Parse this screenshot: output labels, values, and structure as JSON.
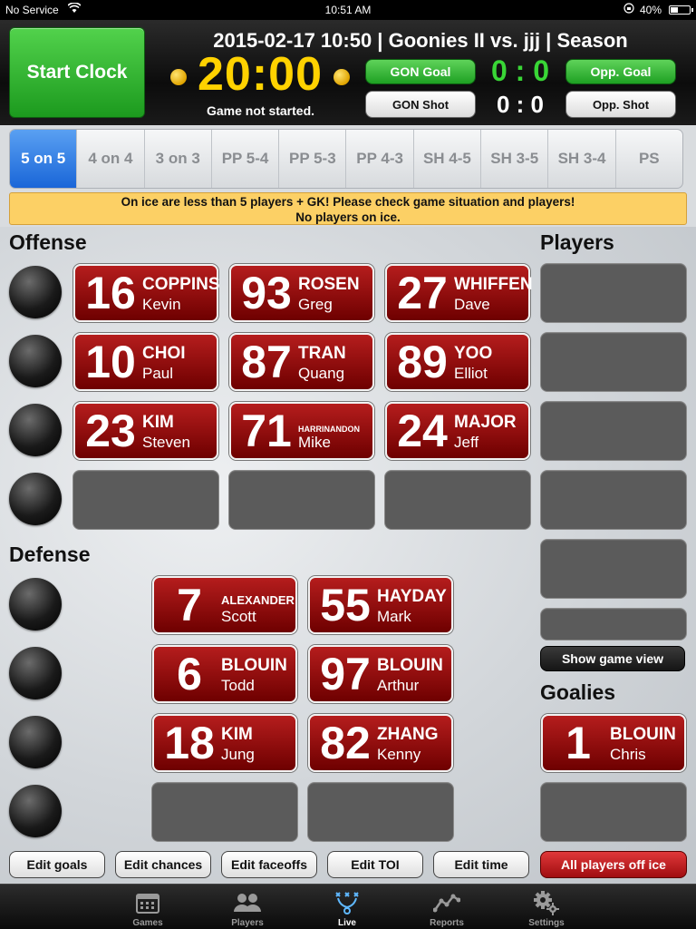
{
  "status_bar": {
    "carrier": "No Service",
    "time": "10:51 AM",
    "battery": "40%",
    "battery_level": 0.4
  },
  "header": {
    "start_clock": "Start Clock",
    "title": "2015-02-17 10:50 | Goonies II vs. jjj | Season",
    "clock_min": "20",
    "clock_sep": ":",
    "clock_sec": "00",
    "clock_status": "Game not started.",
    "home_goal_btn": "GON Goal",
    "home_shot_btn": "GON Shot",
    "opp_goal_btn": "Opp. Goal",
    "opp_shot_btn": "Opp. Shot",
    "goal_score": "0 : 0",
    "shot_score": "0 : 0",
    "colors": {
      "clock": "#ffd200",
      "goal_score": "#39d636",
      "start_clock": "#2fb52c"
    }
  },
  "situations": [
    "5 on 5",
    "4 on 4",
    "3 on 3",
    "PP 5-4",
    "PP 5-3",
    "PP 4-3",
    "SH 4-5",
    "SH 3-5",
    "SH 3-4",
    "PS"
  ],
  "active_situation": "5 on 5",
  "warning": {
    "line1": "On ice are less than 5 players + GK! Please check game situation and players!",
    "line2": "No players on ice."
  },
  "offense": {
    "title": "Offense",
    "lines": [
      [
        {
          "num": "16",
          "last": "COPPINS",
          "first": "Kevin"
        },
        {
          "num": "93",
          "last": "ROSEN",
          "first": "Greg"
        },
        {
          "num": "27",
          "last": "WHIFFEN",
          "first": "Dave"
        }
      ],
      [
        {
          "num": "10",
          "last": "CHOI",
          "first": "Paul"
        },
        {
          "num": "87",
          "last": "TRAN",
          "first": "Quang"
        },
        {
          "num": "89",
          "last": "YOO",
          "first": "Elliot"
        }
      ],
      [
        {
          "num": "23",
          "last": "KIM",
          "first": "Steven"
        },
        {
          "num": "71",
          "last": "HARRINANDON",
          "first": "Mike"
        },
        {
          "num": "24",
          "last": "MAJOR",
          "first": "Jeff"
        }
      ]
    ]
  },
  "defense": {
    "title": "Defense",
    "lines": [
      [
        {
          "num": "7",
          "last": "ALEXANDER",
          "first": "Scott"
        },
        {
          "num": "55",
          "last": "HAYDAY",
          "first": "Mark"
        }
      ],
      [
        {
          "num": "6",
          "last": "BLOUIN",
          "first": "Todd"
        },
        {
          "num": "97",
          "last": "BLOUIN",
          "first": "Arthur"
        }
      ],
      [
        {
          "num": "18",
          "last": "KIM",
          "first": "Jung"
        },
        {
          "num": "82",
          "last": "ZHANG",
          "first": "Kenny"
        }
      ]
    ]
  },
  "players_title": "Players",
  "show_game_view": "Show game view",
  "goalies": {
    "title": "Goalies",
    "list": [
      {
        "num": "1",
        "last": "BLOUIN",
        "first": "Chris"
      }
    ]
  },
  "actions": {
    "edit_goals": "Edit goals",
    "edit_chances": "Edit chances",
    "edit_faceoffs": "Edit faceoffs",
    "edit_toi": "Edit TOI",
    "edit_time": "Edit time",
    "all_off_ice": "All players off ice"
  },
  "tabbar": [
    {
      "label": "Games",
      "icon": "calendar-icon"
    },
    {
      "label": "Players",
      "icon": "people-icon"
    },
    {
      "label": "Live",
      "icon": "play-diagram-icon"
    },
    {
      "label": "Reports",
      "icon": "chart-line-icon"
    },
    {
      "label": "Settings",
      "icon": "gears-icon"
    }
  ],
  "active_tab": "Live"
}
